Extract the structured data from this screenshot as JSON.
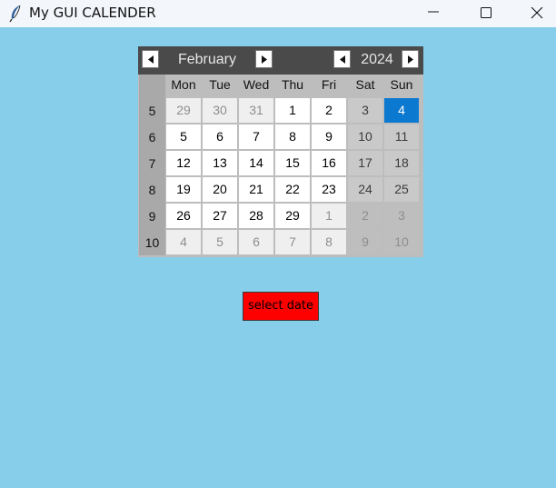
{
  "window": {
    "title": "My GUI CALENDER",
    "controls": [
      "minimize-icon",
      "maximize-icon",
      "close-icon"
    ]
  },
  "calendar": {
    "month": "February",
    "year": "2024",
    "day_headers": [
      "Mon",
      "Tue",
      "Wed",
      "Thu",
      "Fri",
      "Sat",
      "Sun"
    ],
    "weeks": [
      {
        "num": "5",
        "days": [
          [
            "29",
            1
          ],
          [
            "30",
            1
          ],
          [
            "31",
            1
          ],
          [
            "1",
            0
          ],
          [
            "2",
            0
          ],
          [
            "3",
            0
          ],
          [
            "4",
            0
          ]
        ]
      },
      {
        "num": "6",
        "days": [
          [
            "5",
            0
          ],
          [
            "6",
            0
          ],
          [
            "7",
            0
          ],
          [
            "8",
            0
          ],
          [
            "9",
            0
          ],
          [
            "10",
            0
          ],
          [
            "11",
            0
          ]
        ]
      },
      {
        "num": "7",
        "days": [
          [
            "12",
            0
          ],
          [
            "13",
            0
          ],
          [
            "14",
            0
          ],
          [
            "15",
            0
          ],
          [
            "16",
            0
          ],
          [
            "17",
            0
          ],
          [
            "18",
            0
          ]
        ]
      },
      {
        "num": "8",
        "days": [
          [
            "19",
            0
          ],
          [
            "20",
            0
          ],
          [
            "21",
            0
          ],
          [
            "22",
            0
          ],
          [
            "23",
            0
          ],
          [
            "24",
            0
          ],
          [
            "25",
            0
          ]
        ]
      },
      {
        "num": "9",
        "days": [
          [
            "26",
            0
          ],
          [
            "27",
            0
          ],
          [
            "28",
            0
          ],
          [
            "29",
            0
          ],
          [
            "1",
            1
          ],
          [
            "2",
            1
          ],
          [
            "3",
            1
          ]
        ]
      },
      {
        "num": "10",
        "days": [
          [
            "4",
            1
          ],
          [
            "5",
            1
          ],
          [
            "6",
            1
          ],
          [
            "7",
            1
          ],
          [
            "8",
            1
          ],
          [
            "9",
            1
          ],
          [
            "10",
            1
          ]
        ]
      }
    ],
    "selected": "4",
    "colors": {
      "header_bg": "#4a4a4a",
      "selected_bg": "#0b79d0",
      "weekend_bg": "#c9c9c9"
    }
  },
  "select_button": {
    "label": "select date",
    "color": "#ff0000"
  },
  "background_color": "#87ceeb"
}
